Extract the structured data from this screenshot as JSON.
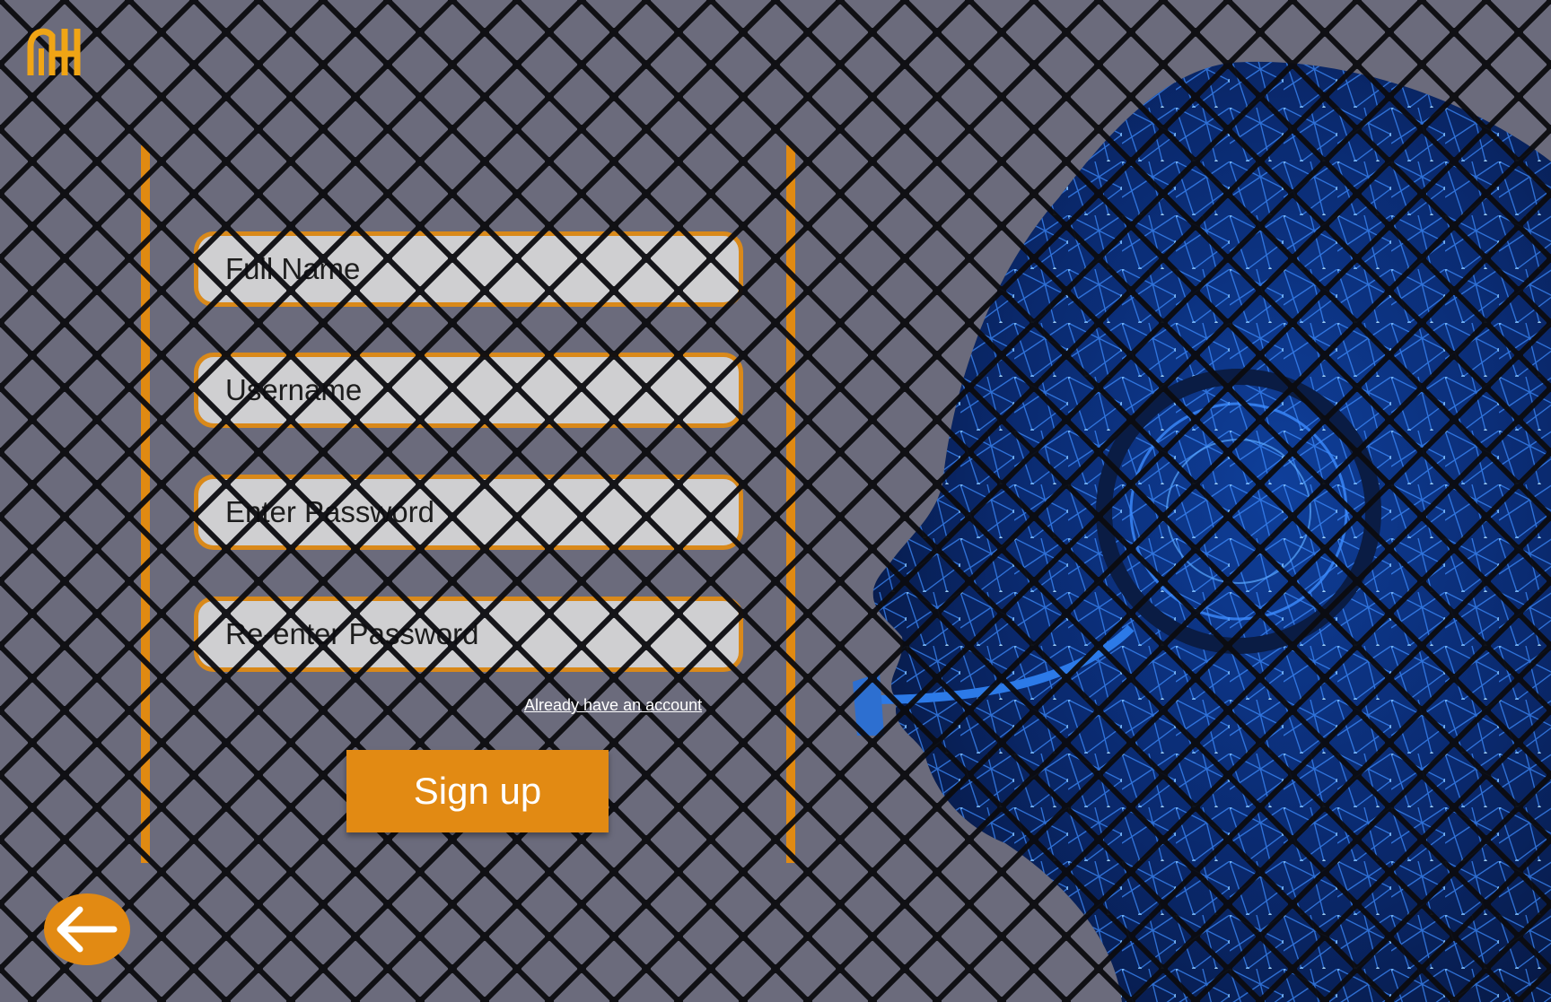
{
  "logo": {
    "icon": "mh-monogram-logo",
    "color": "#f0a515"
  },
  "form": {
    "fields": [
      {
        "placeholder": "Full Name",
        "value": ""
      },
      {
        "placeholder": "Username",
        "value": ""
      },
      {
        "placeholder": "Enter Password",
        "value": ""
      },
      {
        "placeholder": "Re-enter Password",
        "value": ""
      }
    ],
    "login_link": "Already have an account",
    "signup_label": "Sign up"
  },
  "back_button": {
    "icon": "arrow-left-icon"
  },
  "illustration": {
    "icon": "ai-head-headset-illustration",
    "color": "#1f6fe0"
  },
  "colors": {
    "accent": "#e28a13",
    "background": "#6b6b7c",
    "field_bg": "#d8d8d8"
  }
}
